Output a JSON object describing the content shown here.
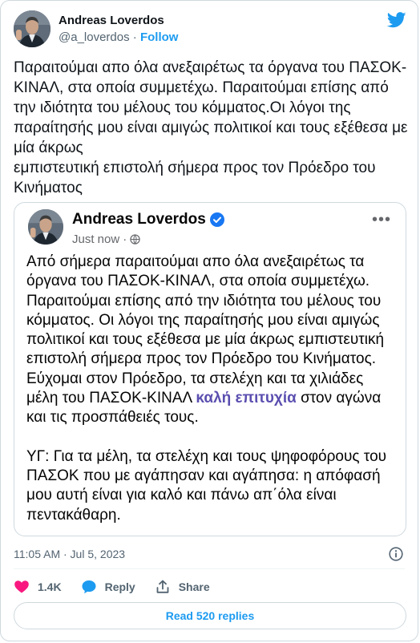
{
  "author": {
    "name": "Andreas Loverdos",
    "handle": "@a_loverdos",
    "separator": "·",
    "follow_label": "Follow"
  },
  "tweet": {
    "text": "Παραιτούμαι απο όλα ανεξαιρέτως τα όργανα του ΠΑΣΟΚ-ΚΙΝΑΛ, στα οποία συμμετέχω. Παραιτούμαι επίσης από την ιδιότητα του μέλους του κόμματος.Οι λόγοι της παραίτησής μου είναι αμιγώς πολιτικοί και τους εξέθεσα με μία άκρως\nεμπιστευτική επιστολή σήμερα προς τον Πρόεδρο του Κινήματος",
    "timestamp": "11:05 AM · Jul 5, 2023"
  },
  "quoted_post": {
    "name": "Andreas Loverdos",
    "time": "Just now",
    "separator": "·",
    "more_label": "•••",
    "paragraph1": "Από σήμερα παραιτούμαι απο όλα ανεξαιρέτως τα όργανα του ΠΑΣΟΚ-ΚΙΝΑΛ, στα οποία συμμετέχω. Παραιτούμαι επίσης από την ιδιότητα του μέλους του κόμματος. Οι λόγοι της παραίτησής μου είναι αμιγώς πολιτικοί και τους εξέθεσα με μία άκρως εμπιστευτική επιστολή σήμερα προς τον Πρόεδρο του Κινήματος.",
    "paragraph2_before": "Εύχομαι στον Πρόεδρο, τα στελέχη και τα χιλιάδες μέλη του ΠΑΣΟΚ-ΚΙΝΑΛ ",
    "paragraph2_highlight": "καλή επιτυχία",
    "paragraph2_after": " στον αγώνα και τις προσπάθειές τους.",
    "paragraph3": "ΥΓ: Για τα μέλη, τα στελέχη και τους ψηφοφόρους του ΠΑΣΟΚ που με αγάπησαν και αγάπησα: η απόφασή μου αυτή είναι για καλό και πάνω απ΄όλα είναι πεντακάθαρη."
  },
  "actions": {
    "likes": "1.4K",
    "reply_label": "Reply",
    "share_label": "Share"
  },
  "read_replies_label": "Read 520 replies",
  "icons": {
    "bird": "twitter-bird-icon",
    "verified": "verified-badge-icon",
    "globe": "globe-icon",
    "info": "info-icon",
    "heart": "heart-icon",
    "reply": "reply-bubble-icon",
    "share": "share-icon"
  },
  "colors": {
    "accent": "#1d9bf0",
    "heart": "#f91880",
    "highlight": "#5b4fb0",
    "secondary_text": "#536471",
    "border": "#cfd9de"
  }
}
